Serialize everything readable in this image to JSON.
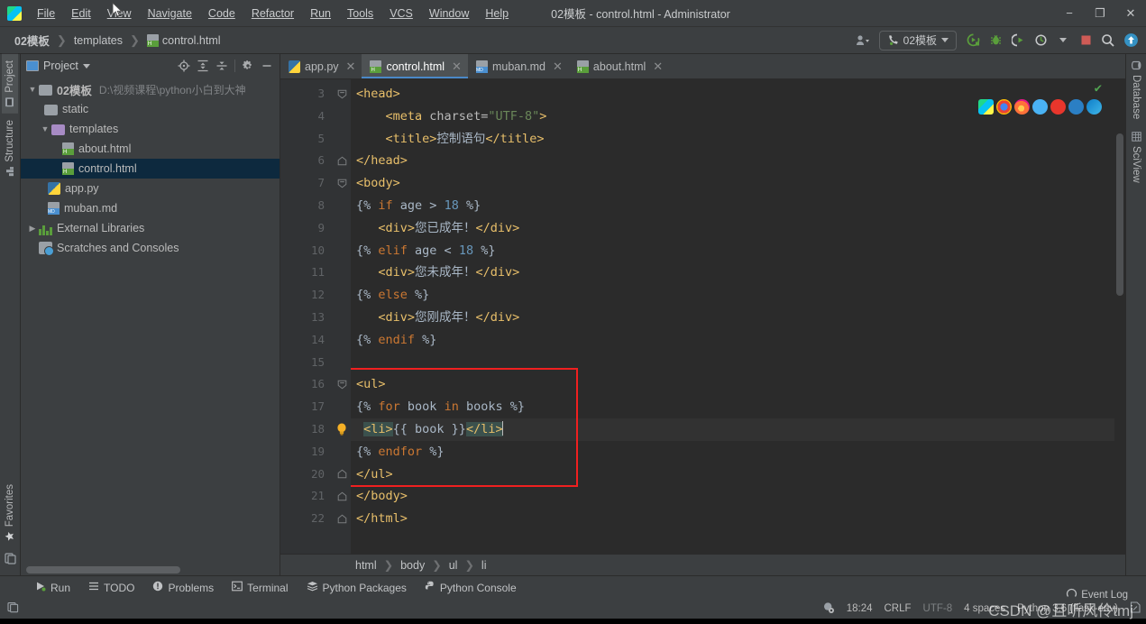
{
  "titlebar": {
    "app_icon": "pycharm-logo-icon",
    "window_title": "02模板 - control.html - Administrator",
    "menus": [
      {
        "label": "File"
      },
      {
        "label": "Edit"
      },
      {
        "label": "View"
      },
      {
        "label": "Navigate"
      },
      {
        "label": "Code"
      },
      {
        "label": "Refactor"
      },
      {
        "label": "Run"
      },
      {
        "label": "Tools"
      },
      {
        "label": "VCS"
      },
      {
        "label": "Window"
      },
      {
        "label": "Help"
      }
    ],
    "window_controls": {
      "minimize": "−",
      "maximize": "❐",
      "close": "✕"
    }
  },
  "navbar": {
    "breadcrumbs": [
      {
        "label": "02模板",
        "icon": ""
      },
      {
        "label": "templates",
        "icon": ""
      },
      {
        "label": "control.html",
        "icon": "html-file-icon"
      }
    ],
    "separator": "❯",
    "run_config": "02模板",
    "toolbar_icons": [
      "user-settings-icon",
      "run-icon",
      "debug-icon",
      "run-coverage-icon",
      "profile-icon",
      "stop-icon",
      "search-everywhere-icon",
      "update-project-icon"
    ]
  },
  "left_toolstrip": {
    "tabs": [
      {
        "label": "Project",
        "icon": "project-icon",
        "active": true
      },
      {
        "label": "Structure",
        "icon": "structure-icon",
        "active": false
      },
      {
        "label": "Favorites",
        "icon": "star-icon",
        "active": false
      }
    ],
    "bottom_icon": "terminal-toggle-icon"
  },
  "right_toolstrip": {
    "tabs": [
      {
        "label": "Database",
        "icon": "database-icon"
      },
      {
        "label": "SciView",
        "icon": "sciview-icon"
      }
    ]
  },
  "project_panel": {
    "title": "Project",
    "title_icon": "project-window-icon",
    "tools": [
      "locate-icon",
      "expand-all-icon",
      "collapse-all-icon",
      "settings-gear-icon",
      "hide-panel-icon"
    ],
    "tree": [
      {
        "label": "02模板",
        "path": "D:\\视频课程\\python小白到大神",
        "icon": "folder-icon",
        "depth": 0,
        "arrow": "expanded",
        "bold": true,
        "selected": false
      },
      {
        "label": "static",
        "path": "",
        "icon": "folder-icon",
        "depth": 1,
        "arrow": "none",
        "bold": false,
        "selected": false
      },
      {
        "label": "templates",
        "path": "",
        "icon": "folder-purple-icon",
        "depth": 1,
        "arrow": "expanded",
        "bold": false,
        "selected": false
      },
      {
        "label": "about.html",
        "path": "",
        "icon": "html-file-icon",
        "depth": 2,
        "arrow": "none",
        "bold": false,
        "selected": false
      },
      {
        "label": "control.html",
        "path": "",
        "icon": "html-file-icon",
        "depth": 2,
        "arrow": "none",
        "bold": false,
        "selected": true
      },
      {
        "label": "app.py",
        "path": "",
        "icon": "python-file-icon",
        "depth": 1,
        "arrow": "none",
        "bold": false,
        "selected": false
      },
      {
        "label": "muban.md",
        "path": "",
        "icon": "markdown-file-icon",
        "depth": 1,
        "arrow": "none",
        "bold": false,
        "selected": false
      },
      {
        "label": "External Libraries",
        "path": "",
        "icon": "library-icon",
        "depth": 0,
        "arrow": "collapsed",
        "bold": false,
        "selected": false
      },
      {
        "label": "Scratches and Consoles",
        "path": "",
        "icon": "scratches-icon",
        "depth": 0,
        "arrow": "none",
        "bold": false,
        "selected": false
      }
    ]
  },
  "editor": {
    "tabs": [
      {
        "label": "app.py",
        "icon": "python-file-icon",
        "active": false
      },
      {
        "label": "control.html",
        "icon": "html-file-icon",
        "active": true
      },
      {
        "label": "muban.md",
        "icon": "markdown-file-icon",
        "active": false
      },
      {
        "label": "about.html",
        "icon": "html-file-icon",
        "active": false
      }
    ],
    "close_glyph": "✕",
    "first_line_number": 3,
    "inspection_status": "✔",
    "browser_icons": [
      "pycharm-preview-icon",
      "chrome-icon",
      "firefox-icon",
      "safari-icon",
      "opera-icon",
      "ie-icon",
      "edge-icon"
    ],
    "lines": [
      {
        "n": 3,
        "fold": "open",
        "bulb": false,
        "cur": false,
        "tokens": [
          {
            "t": "<head>",
            "c": "tag"
          }
        ]
      },
      {
        "n": 4,
        "fold": "none",
        "bulb": false,
        "cur": false,
        "tokens": [
          {
            "t": "    ",
            "c": "plain"
          },
          {
            "t": "<meta ",
            "c": "tag"
          },
          {
            "t": "charset=",
            "c": "attr"
          },
          {
            "t": "\"UTF-8\"",
            "c": "str"
          },
          {
            "t": ">",
            "c": "tag"
          }
        ]
      },
      {
        "n": 5,
        "fold": "none",
        "bulb": false,
        "cur": false,
        "tokens": [
          {
            "t": "    ",
            "c": "plain"
          },
          {
            "t": "<title>",
            "c": "tag"
          },
          {
            "t": "控制语句",
            "c": "txt"
          },
          {
            "t": "</title>",
            "c": "tag"
          }
        ]
      },
      {
        "n": 6,
        "fold": "close",
        "bulb": false,
        "cur": false,
        "tokens": [
          {
            "t": "</head>",
            "c": "tag"
          }
        ]
      },
      {
        "n": 7,
        "fold": "open",
        "bulb": false,
        "cur": false,
        "tokens": [
          {
            "t": "<body>",
            "c": "tag"
          }
        ]
      },
      {
        "n": 8,
        "fold": "none",
        "bulb": false,
        "cur": false,
        "tokens": [
          {
            "t": "{% ",
            "c": "plain"
          },
          {
            "t": "if",
            "c": "kw"
          },
          {
            "t": " age > ",
            "c": "plain"
          },
          {
            "t": "18",
            "c": "num"
          },
          {
            "t": " %}",
            "c": "plain"
          }
        ]
      },
      {
        "n": 9,
        "fold": "none",
        "bulb": false,
        "cur": false,
        "tokens": [
          {
            "t": "   ",
            "c": "plain"
          },
          {
            "t": "<div>",
            "c": "tag"
          },
          {
            "t": "您已成年！",
            "c": "txt"
          },
          {
            "t": "</div>",
            "c": "tag"
          }
        ]
      },
      {
        "n": 10,
        "fold": "none",
        "bulb": false,
        "cur": false,
        "tokens": [
          {
            "t": "{% ",
            "c": "plain"
          },
          {
            "t": "elif",
            "c": "kw"
          },
          {
            "t": " age < ",
            "c": "plain"
          },
          {
            "t": "18",
            "c": "num"
          },
          {
            "t": " %}",
            "c": "plain"
          }
        ]
      },
      {
        "n": 11,
        "fold": "none",
        "bulb": false,
        "cur": false,
        "tokens": [
          {
            "t": "   ",
            "c": "plain"
          },
          {
            "t": "<div>",
            "c": "tag"
          },
          {
            "t": "您未成年！",
            "c": "txt"
          },
          {
            "t": "</div>",
            "c": "tag"
          }
        ]
      },
      {
        "n": 12,
        "fold": "none",
        "bulb": false,
        "cur": false,
        "tokens": [
          {
            "t": "{% ",
            "c": "plain"
          },
          {
            "t": "else",
            "c": "kw"
          },
          {
            "t": " %}",
            "c": "plain"
          }
        ]
      },
      {
        "n": 13,
        "fold": "none",
        "bulb": false,
        "cur": false,
        "tokens": [
          {
            "t": "   ",
            "c": "plain"
          },
          {
            "t": "<div>",
            "c": "tag"
          },
          {
            "t": "您刚成年！",
            "c": "txt"
          },
          {
            "t": "</div>",
            "c": "tag"
          }
        ]
      },
      {
        "n": 14,
        "fold": "none",
        "bulb": false,
        "cur": false,
        "tokens": [
          {
            "t": "{% ",
            "c": "plain"
          },
          {
            "t": "endif",
            "c": "kw"
          },
          {
            "t": " %}",
            "c": "plain"
          }
        ]
      },
      {
        "n": 15,
        "fold": "none",
        "bulb": false,
        "cur": false,
        "tokens": []
      },
      {
        "n": 16,
        "fold": "open",
        "bulb": false,
        "cur": false,
        "tokens": [
          {
            "t": "<ul>",
            "c": "tag"
          }
        ]
      },
      {
        "n": 17,
        "fold": "none",
        "bulb": false,
        "cur": false,
        "tokens": [
          {
            "t": "{% ",
            "c": "plain"
          },
          {
            "t": "for",
            "c": "kw"
          },
          {
            "t": " book ",
            "c": "plain"
          },
          {
            "t": "in",
            "c": "kw"
          },
          {
            "t": " books %}",
            "c": "plain"
          }
        ]
      },
      {
        "n": 18,
        "fold": "none",
        "bulb": true,
        "cur": true,
        "tokens": [
          {
            "t": " ",
            "c": "plain"
          },
          {
            "t": "<li>",
            "c": "tag",
            "hl": true
          },
          {
            "t": "{{ book }}",
            "c": "plain"
          },
          {
            "t": "</li>",
            "c": "tag",
            "hl": true
          }
        ],
        "caret": true
      },
      {
        "n": 19,
        "fold": "none",
        "bulb": false,
        "cur": false,
        "tokens": [
          {
            "t": "{% ",
            "c": "plain"
          },
          {
            "t": "endfor",
            "c": "kw"
          },
          {
            "t": " %}",
            "c": "plain"
          }
        ]
      },
      {
        "n": 20,
        "fold": "close",
        "bulb": false,
        "cur": false,
        "tokens": [
          {
            "t": "</ul>",
            "c": "tag"
          }
        ]
      },
      {
        "n": 21,
        "fold": "close",
        "bulb": false,
        "cur": false,
        "tokens": [
          {
            "t": "</body>",
            "c": "tag"
          }
        ]
      },
      {
        "n": 22,
        "fold": "close",
        "bulb": false,
        "cur": false,
        "tokens": [
          {
            "t": "</html>",
            "c": "tag"
          }
        ]
      }
    ],
    "annotation_box": {
      "color": "#f02020",
      "from_line": 16,
      "to_line": 20
    },
    "breadcrumbs": [
      "html",
      "body",
      "ul",
      "li"
    ],
    "breadcrumb_separator": "❯"
  },
  "bottom_bar": {
    "items": [
      {
        "label": "Run",
        "icon": "run-triangle-icon"
      },
      {
        "label": "TODO",
        "icon": "todo-list-icon"
      },
      {
        "label": "Problems",
        "icon": "problems-icon"
      },
      {
        "label": "Terminal",
        "icon": "terminal-icon"
      },
      {
        "label": "Python Packages",
        "icon": "packages-icon"
      },
      {
        "label": "Python Console",
        "icon": "python-console-icon"
      }
    ]
  },
  "statusbar": {
    "left_icon": "show-tool-windows-icon",
    "sync_icon": "sync-icon",
    "time": "18:24",
    "line_separator": "CRLF",
    "encoding": "UTF-8",
    "indent": "4 spaces",
    "interpreter": "Python 3.6 (flask-env)",
    "event_log": "Event Log",
    "event_log_icon": "event-log-icon",
    "lock_icon": "write-access-icon",
    "watermark": "CSDN @且听风伶tmj"
  }
}
